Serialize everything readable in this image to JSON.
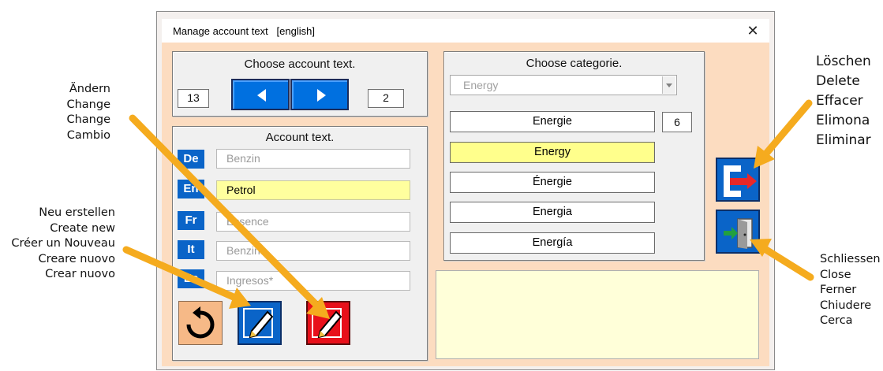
{
  "window": {
    "title": "Manage account text   [english]",
    "close_glyph": "✕"
  },
  "account_group": {
    "title": "Choose account text.",
    "left_value": "13",
    "right_value": "2"
  },
  "text_group": {
    "title": "Account text.",
    "rows": [
      {
        "lang": "De",
        "value": "Benzin"
      },
      {
        "lang": "En",
        "value": "Petrol"
      },
      {
        "lang": "Fr",
        "value": "Essence"
      },
      {
        "lang": "It",
        "value": "Benzina"
      },
      {
        "lang": "Es",
        "value": "Ingresos*"
      }
    ]
  },
  "category_group": {
    "title": "Choose categorie.",
    "dropdown_value": "Energy",
    "count": "6",
    "items": [
      "Energie",
      "Energy",
      "Énergie",
      "Energia",
      "Energía"
    ]
  },
  "annotations": {
    "change": [
      "Ändern",
      "Change",
      "Change",
      "Cambio"
    ],
    "new": [
      "Neu erstellen",
      "Create new",
      "Créer un Nouveau",
      "Creare nuovo",
      "Crear nuovo"
    ],
    "delete": [
      "Löschen",
      "Delete",
      "Effacer",
      "Elimona",
      "Eliminar"
    ],
    "close": [
      "Schliessen",
      "Close",
      "Ferner",
      "Chiudere",
      "Cerca"
    ]
  },
  "icons": {
    "prev": "left-arrow-icon",
    "next": "right-arrow-icon",
    "reset": "refresh-icon",
    "new": "pencil-icon",
    "change": "pencil-icon",
    "delete": "delete-icon",
    "close": "exit-door-icon"
  },
  "colors": {
    "accent_blue": "#0070e0",
    "highlight_yellow": "#ffff9e",
    "client_peach": "#fcdcc0",
    "arrow_orange": "#f5ab1e",
    "change_red": "#e8101a",
    "reset_peach": "#f6b987"
  }
}
